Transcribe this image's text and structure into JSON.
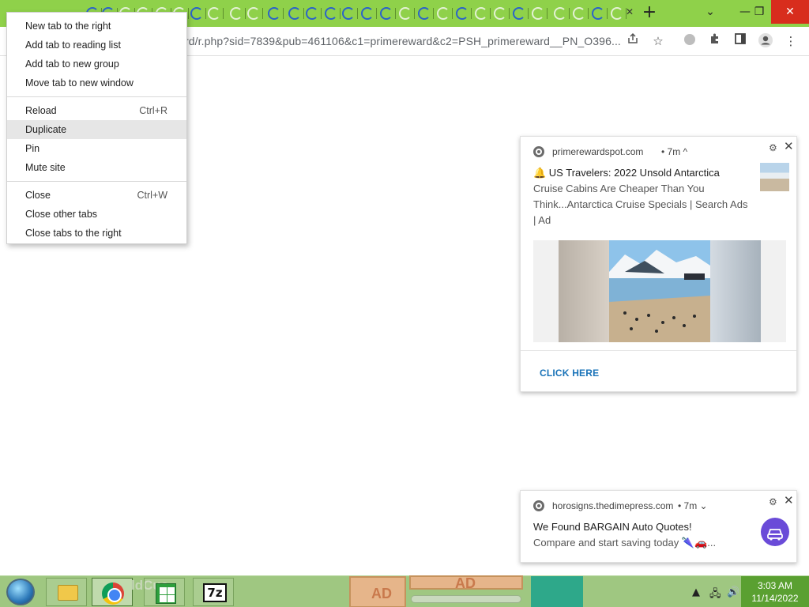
{
  "browser": {
    "tab_close_glyph": "✕",
    "new_tab_glyph": "+",
    "url": "rd/r.php?sid=7839&pub=461106&c1=primereward&c2=PSH_primereward__PN_O396...",
    "window_controls": {
      "dropdown": "⌄",
      "minimize": "—",
      "restore": "❐",
      "close": "✕"
    },
    "toolbar_icons": [
      "share-icon",
      "star-icon",
      "extension-puzzle-icon",
      "side-panel-icon",
      "profile-icon",
      "menu-dots-icon"
    ],
    "accent_color": "#8fd14a"
  },
  "context_menu": {
    "items": [
      {
        "label": "New tab to the right",
        "shortcut": ""
      },
      {
        "label": "Add tab to reading list",
        "shortcut": ""
      },
      {
        "label": "Add tab to new group",
        "shortcut": ""
      },
      {
        "label": "Move tab to new window",
        "shortcut": ""
      },
      {
        "label": "Reload",
        "shortcut": "Ctrl+R"
      },
      {
        "label": "Duplicate",
        "shortcut": "",
        "highlighted": true
      },
      {
        "label": "Pin",
        "shortcut": ""
      },
      {
        "label": "Mute site",
        "shortcut": ""
      },
      {
        "label": "Close",
        "shortcut": "Ctrl+W"
      },
      {
        "label": "Close other tabs",
        "shortcut": ""
      },
      {
        "label": "Close tabs to the right",
        "shortcut": ""
      }
    ]
  },
  "notifications": [
    {
      "site": "primerewardspot.com",
      "time": "• 7m ^",
      "title": "🔔 US Travelers: 2022 Unsold Antarctica",
      "body": "Cruise Cabins Are Cheaper Than You Think...Antarctica Cruise Specials | Search Ads | Ad",
      "cta": "CLICK HERE"
    },
    {
      "site": "horosigns.thedimepress.com",
      "time": "• 7m ⌄",
      "title": "We Found BARGAIN Auto Quotes!",
      "body": "Compare and start saving today 🌂🚗..."
    }
  ],
  "taskbar": {
    "faded_text": "ldCue",
    "ad_labels": [
      "AD",
      "AD"
    ],
    "clock_time": "3:03 AM",
    "clock_date": "11/14/2022",
    "tray_icons": [
      "show-hidden-icons-icon",
      "network-icon",
      "volume-icon"
    ]
  }
}
